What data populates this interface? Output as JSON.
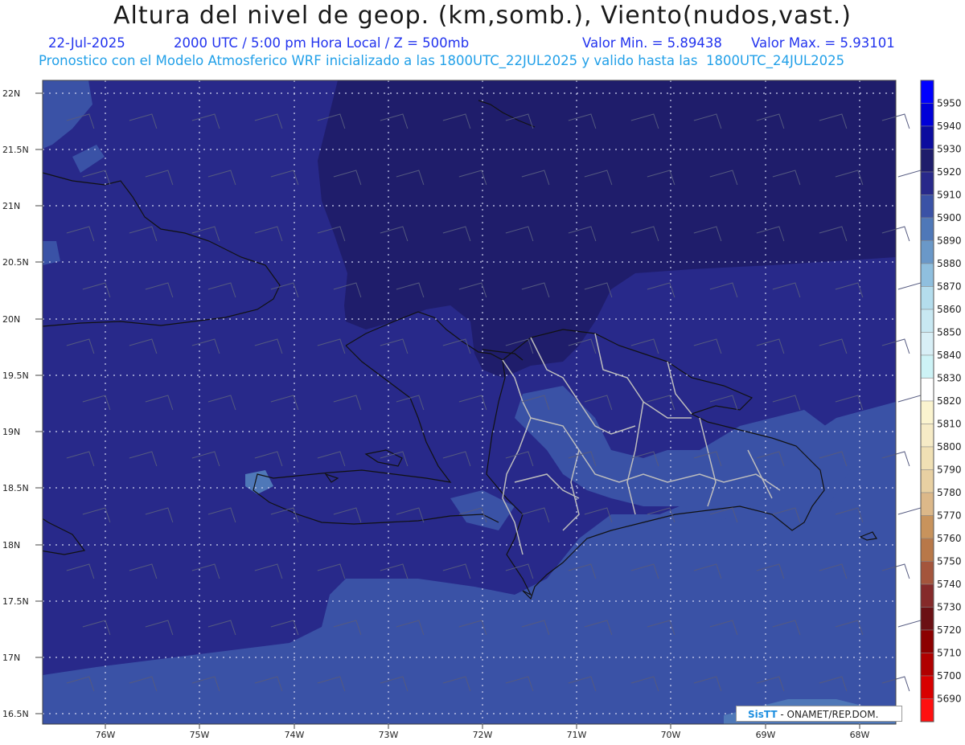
{
  "header": {
    "title": "Altura del nivel de geop. (km,somb.), Viento(nudos,vast.)",
    "date": "22-Jul-2025",
    "time_info": "2000 UTC / 5:00 pm Hora Local / Z = 500mb",
    "min_label": "Valor Min. = 5.89438",
    "max_label": "Valor Max. = 5.93101",
    "model_info": "Pronostico con el Modelo Atmosferico WRF inicializado a las 1800UTC_22JUL2025 y valido hasta las  1800UTC_24JUL2025"
  },
  "map": {
    "lat_labels": [
      "22N",
      "21.5N",
      "21N",
      "20.5N",
      "20N",
      "19.5N",
      "19N",
      "18.5N",
      "18N",
      "17.5N",
      "17N",
      "16.5N"
    ],
    "lon_labels": [
      "76W",
      "75W",
      "74W",
      "73W",
      "72W",
      "71W",
      "70W",
      "69W",
      "68W"
    ],
    "colors": {
      "c5920": "#1f1d6b",
      "c5910": "#28298a",
      "c5900": "#3a52a6",
      "c5890": "#4f78b8",
      "coast": "#111111",
      "provinces": "#bdbdbd"
    }
  },
  "colorbar": {
    "levels": [
      {
        "value": "5950",
        "color": "#0000ff"
      },
      {
        "value": "5940",
        "color": "#0000d8"
      },
      {
        "value": "5930",
        "color": "#0c0c9e"
      },
      {
        "value": "5920",
        "color": "#1f1d6b"
      },
      {
        "value": "5910",
        "color": "#28298a"
      },
      {
        "value": "5900",
        "color": "#3a52a6"
      },
      {
        "value": "5890",
        "color": "#4f78b8"
      },
      {
        "value": "5880",
        "color": "#6a98c8"
      },
      {
        "value": "5870",
        "color": "#8fbfde"
      },
      {
        "value": "5860",
        "color": "#b4dded"
      },
      {
        "value": "5850",
        "color": "#c8e8f2"
      },
      {
        "value": "5840",
        "color": "#d8eff6"
      },
      {
        "value": "5830",
        "color": "#cdf3f6"
      },
      {
        "value": "5820",
        "color": "#ffffff"
      },
      {
        "value": "5810",
        "color": "#fbf4cf"
      },
      {
        "value": "5800",
        "color": "#f6ebc6"
      },
      {
        "value": "5790",
        "color": "#f0e0b4"
      },
      {
        "value": "5780",
        "color": "#e8d0a2"
      },
      {
        "value": "5770",
        "color": "#dcb889"
      },
      {
        "value": "5760",
        "color": "#c8935c"
      },
      {
        "value": "5750",
        "color": "#b87848"
      },
      {
        "value": "5740",
        "color": "#a4553c"
      },
      {
        "value": "5730",
        "color": "#852a2a"
      },
      {
        "value": "5720",
        "color": "#6b1014"
      },
      {
        "value": "5710",
        "color": "#8c0000"
      },
      {
        "value": "5700",
        "color": "#b00000"
      },
      {
        "value": "5690",
        "color": "#d80000"
      },
      {
        "value": "",
        "color": "#ff1010"
      }
    ]
  },
  "credit": {
    "logo": "SisTT",
    "text": "- ONAMET/REP.DOM."
  }
}
